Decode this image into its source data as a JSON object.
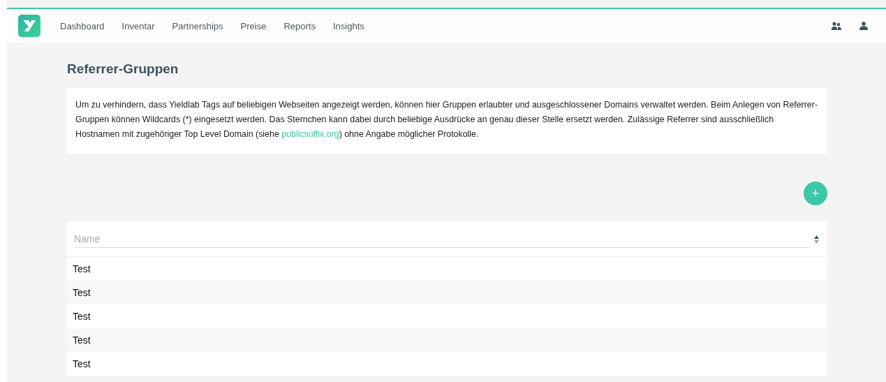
{
  "nav": {
    "items": [
      {
        "label": "Dashboard"
      },
      {
        "label": "Inventar"
      },
      {
        "label": "Partnerships"
      },
      {
        "label": "Preise"
      },
      {
        "label": "Reports"
      },
      {
        "label": "Insights"
      }
    ]
  },
  "title": "Referrer-Gruppen",
  "description": {
    "before": "Um zu verhindern, dass Yieldlab Tags auf beliebigen Webseiten angezeigt werden, können hier Gruppen erlaubter und ausgeschlossener Domains verwaltet werden. Beim Anlegen von Referrer-Gruppen können Wildcards (*) eingesetzt werden. Das Sternchen kann dabei durch beliebige Ausdrücke an genau dieser Stelle ersetzt werden. Zulässige Referrer sind ausschließlich Hostnamen mit zugehöriger Top Level Domain (siehe ",
    "link": "publicsuffix.org",
    "after": ") ohne Angabe möglicher Protokolle."
  },
  "add_button": "+",
  "table": {
    "filter": {
      "placeholder": "Name"
    },
    "rows": [
      {
        "name": "Test"
      },
      {
        "name": "Test"
      },
      {
        "name": "Test"
      },
      {
        "name": "Test"
      },
      {
        "name": "Test"
      }
    ]
  }
}
